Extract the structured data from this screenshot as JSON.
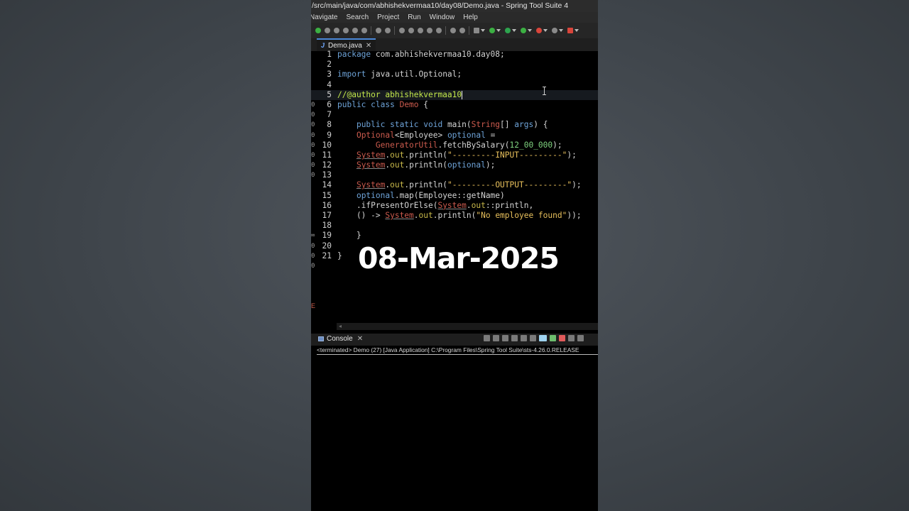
{
  "window": {
    "title": "/src/main/java/com/abhishekvermaa10/day08/Demo.java - Spring Tool Suite 4"
  },
  "menu": [
    "Navigate",
    "Search",
    "Project",
    "Run",
    "Window",
    "Help"
  ],
  "editor": {
    "tab_label": "Demo.java",
    "tab_icon": "java-file-icon",
    "lines": [
      {
        "n": "1",
        "code": "package com.abhishekvermaa10.day08;"
      },
      {
        "n": "2",
        "code": ""
      },
      {
        "n": "3",
        "code": "import java.util.Optional;"
      },
      {
        "n": "4",
        "code": ""
      },
      {
        "n": "5",
        "code": "//@author abhishekvermaa10"
      },
      {
        "n": "6",
        "code": "public class Demo {"
      },
      {
        "n": "7",
        "code": ""
      },
      {
        "n": "8",
        "code": "    public static void main(String[] args) {"
      },
      {
        "n": "9",
        "code": "    Optional<Employee> optional ="
      },
      {
        "n": "10",
        "code": "        GeneratorUtil.fetchBySalary(12_00_000);"
      },
      {
        "n": "11",
        "code": "    System.out.println(\"---------INPUT---------\");"
      },
      {
        "n": "12",
        "code": "    System.out.println(optional);"
      },
      {
        "n": "13",
        "code": ""
      },
      {
        "n": "14",
        "code": "    System.out.println(\"---------OUTPUT---------\");"
      },
      {
        "n": "15",
        "code": "    optional.map(Employee::getName)"
      },
      {
        "n": "16",
        "code": "    .ifPresentOrElse(System.out::println,"
      },
      {
        "n": "17",
        "code": "    () -> System.out.println(\"No employee found\"));"
      },
      {
        "n": "18",
        "code": ""
      },
      {
        "n": "19",
        "code": "    }"
      },
      {
        "n": "20",
        "code": ""
      },
      {
        "n": "21",
        "code": "}"
      }
    ]
  },
  "overlay": {
    "date": "08-Mar-2025"
  },
  "console": {
    "tab_label": "Console",
    "status": "<terminated> Demo (27) [Java Application] C:\\Program Files\\Spring Tool Suite\\sts-4.26.0.RELEASE"
  },
  "colors": {
    "keyword": "#6ea3d8",
    "type": "#cc5b4e",
    "field": "#c9b94a",
    "string": "#e8c05c",
    "comment": "#c3e84b",
    "number": "#7fd37f",
    "page_background": "#454b51",
    "ide_background": "#000000"
  }
}
